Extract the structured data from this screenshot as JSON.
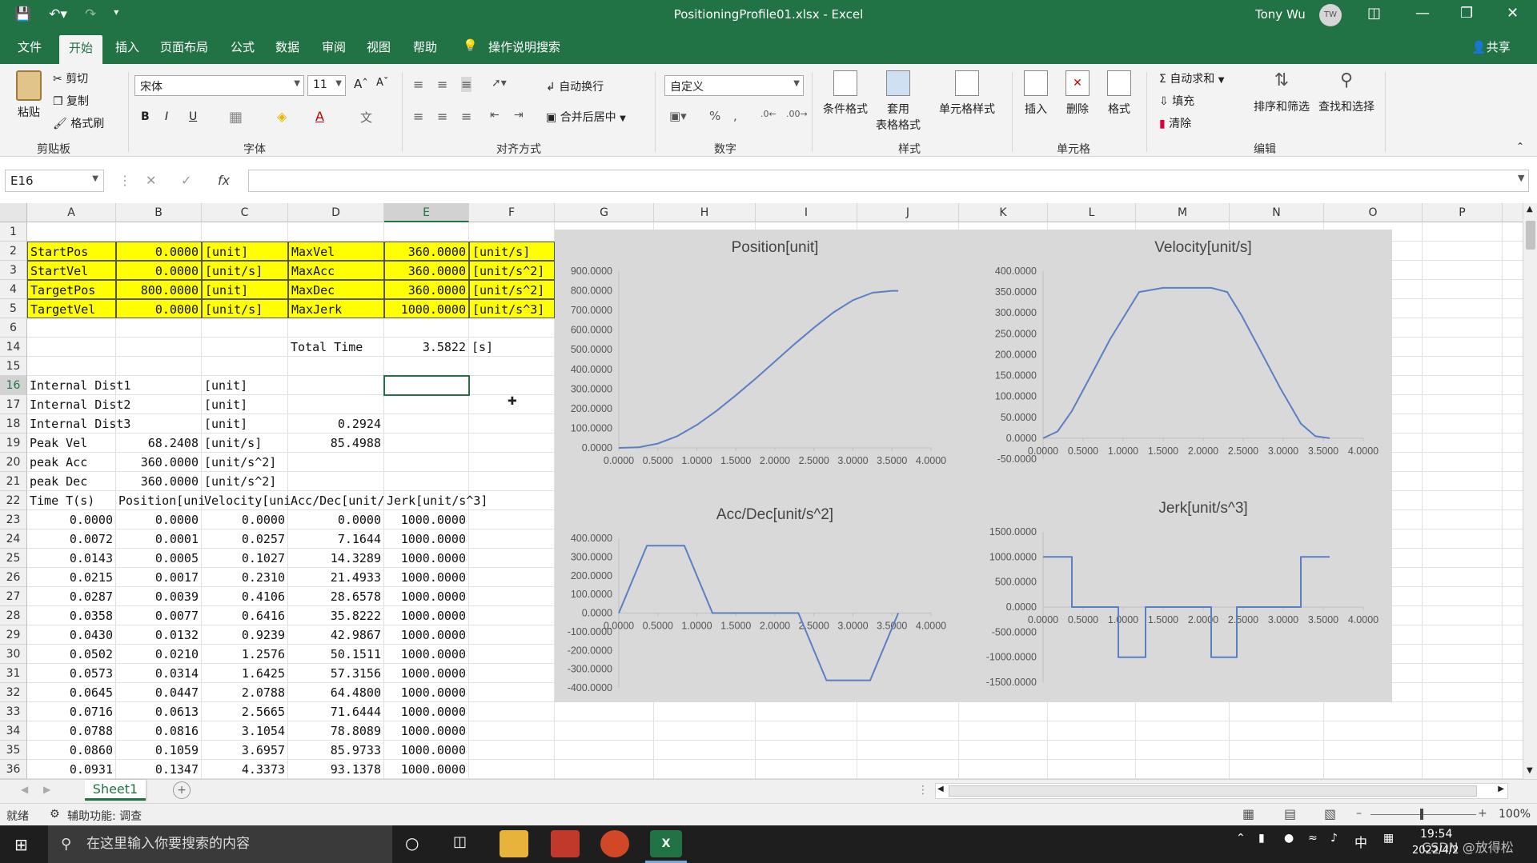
{
  "window": {
    "title": "PositioningProfile01.xlsx  -  Excel",
    "user": "Tony Wu",
    "avatar": "TW"
  },
  "menu_tabs": [
    "文件",
    "开始",
    "插入",
    "页面布局",
    "公式",
    "数据",
    "审阅",
    "视图",
    "帮助",
    "操作说明搜索"
  ],
  "share_label": "共享",
  "ribbon": {
    "clipboard": {
      "paste": "粘贴",
      "cut": "剪切",
      "copy": "复制",
      "format_painter": "格式刷",
      "label": "剪贴板"
    },
    "font": {
      "name": "宋体",
      "size": "11",
      "label": "字体"
    },
    "alignment": {
      "wrap": "自动换行",
      "merge": "合并后居中",
      "label": "对齐方式"
    },
    "number": {
      "format": "自定义",
      "label": "数字"
    },
    "styles": {
      "conditional": "条件格式",
      "table_line1": "套用",
      "table_line2": "表格格式",
      "cell_style": "单元格样式",
      "label": "样式"
    },
    "cells": {
      "insert": "插入",
      "delete": "删除",
      "format": "格式",
      "label": "单元格"
    },
    "editing": {
      "autosum": "自动求和",
      "fill": "填充",
      "clear": "清除",
      "sort": "排序和筛选",
      "find": "查找和选择",
      "label": "编辑"
    }
  },
  "formula_bar": {
    "name_box": "E16",
    "formula": ""
  },
  "columns": [
    "A",
    "B",
    "C",
    "D",
    "E",
    "F",
    "G",
    "H",
    "I",
    "J",
    "K",
    "L",
    "M",
    "N",
    "O",
    "P",
    "Q",
    "R",
    "S"
  ],
  "rows": [
    {
      "n": "1",
      "cells": [
        "",
        "",
        "",
        "",
        "",
        ""
      ]
    },
    {
      "n": "2",
      "cells": [
        "StartPos",
        "0.0000",
        "[unit]",
        "MaxVel",
        "360.0000",
        "[unit/s]"
      ]
    },
    {
      "n": "3",
      "cells": [
        "StartVel",
        "0.0000",
        "[unit/s]",
        "MaxAcc",
        "360.0000",
        "[unit/s^2]"
      ]
    },
    {
      "n": "4",
      "cells": [
        "TargetPos",
        "800.0000",
        "[unit]",
        "MaxDec",
        "360.0000",
        "[unit/s^2]"
      ]
    },
    {
      "n": "5",
      "cells": [
        "TargetVel",
        "0.0000",
        "[unit/s]",
        "MaxJerk",
        "1000.0000",
        "[unit/s^3]"
      ]
    },
    {
      "n": "6",
      "cells": [
        "",
        "",
        "",
        "",
        "",
        ""
      ]
    },
    {
      "n": "14",
      "cells": [
        "",
        "",
        "",
        "Total Time",
        "3.5822",
        "[s]"
      ]
    },
    {
      "n": "15",
      "cells": [
        "",
        "",
        "",
        "",
        "",
        ""
      ]
    },
    {
      "n": "16",
      "cells": [
        "Internal Dist1",
        "",
        "[unit]",
        "",
        "",
        ""
      ]
    },
    {
      "n": "17",
      "cells": [
        "Internal Dist2",
        "",
        "[unit]",
        "",
        "",
        ""
      ]
    },
    {
      "n": "18",
      "cells": [
        "Internal Dist3",
        "",
        "[unit]",
        "0.2924",
        "",
        ""
      ]
    },
    {
      "n": "19",
      "cells": [
        "Peak Vel",
        "68.2408",
        "[unit/s]",
        "85.4988",
        "",
        ""
      ]
    },
    {
      "n": "20",
      "cells": [
        "peak Acc",
        "360.0000",
        "[unit/s^2]",
        "",
        "",
        ""
      ]
    },
    {
      "n": "21",
      "cells": [
        "peak Dec",
        "360.0000",
        "[unit/s^2]",
        "",
        "",
        ""
      ]
    },
    {
      "n": "22",
      "cells": [
        "Time T(s)",
        "Position[uni",
        "Velocity[uni",
        "Acc/Dec[unit/",
        "Jerk[unit/s^3]",
        ""
      ]
    },
    {
      "n": "23",
      "cells": [
        "0.0000",
        "0.0000",
        "0.0000",
        "0.0000",
        "1000.0000",
        ""
      ]
    },
    {
      "n": "24",
      "cells": [
        "0.0072",
        "0.0001",
        "0.0257",
        "7.1644",
        "1000.0000",
        ""
      ]
    },
    {
      "n": "25",
      "cells": [
        "0.0143",
        "0.0005",
        "0.1027",
        "14.3289",
        "1000.0000",
        ""
      ]
    },
    {
      "n": "26",
      "cells": [
        "0.0215",
        "0.0017",
        "0.2310",
        "21.4933",
        "1000.0000",
        ""
      ]
    },
    {
      "n": "27",
      "cells": [
        "0.0287",
        "0.0039",
        "0.4106",
        "28.6578",
        "1000.0000",
        ""
      ]
    },
    {
      "n": "28",
      "cells": [
        "0.0358",
        "0.0077",
        "0.6416",
        "35.8222",
        "1000.0000",
        ""
      ]
    },
    {
      "n": "29",
      "cells": [
        "0.0430",
        "0.0132",
        "0.9239",
        "42.9867",
        "1000.0000",
        ""
      ]
    },
    {
      "n": "30",
      "cells": [
        "0.0502",
        "0.0210",
        "1.2576",
        "50.1511",
        "1000.0000",
        ""
      ]
    },
    {
      "n": "31",
      "cells": [
        "0.0573",
        "0.0314",
        "1.6425",
        "57.3156",
        "1000.0000",
        ""
      ]
    },
    {
      "n": "32",
      "cells": [
        "0.0645",
        "0.0447",
        "2.0788",
        "64.4800",
        "1000.0000",
        ""
      ]
    },
    {
      "n": "33",
      "cells": [
        "0.0716",
        "0.0613",
        "2.5665",
        "71.6444",
        "1000.0000",
        ""
      ]
    },
    {
      "n": "34",
      "cells": [
        "0.0788",
        "0.0816",
        "3.1054",
        "78.8089",
        "1000.0000",
        ""
      ]
    },
    {
      "n": "35",
      "cells": [
        "0.0860",
        "0.1059",
        "3.6957",
        "85.9733",
        "1000.0000",
        ""
      ]
    },
    {
      "n": "36",
      "cells": [
        "0.0931",
        "0.1347",
        "4.3373",
        "93.1378",
        "1000.0000",
        ""
      ]
    }
  ],
  "chart_data": [
    {
      "type": "line",
      "title": "Position[unit]",
      "xlim": [
        0,
        4
      ],
      "ylim": [
        0,
        900
      ],
      "x_ticks": [
        "0.0000",
        "0.5000",
        "1.0000",
        "1.5000",
        "2.0000",
        "2.5000",
        "3.0000",
        "3.5000",
        "4.0000"
      ],
      "y_ticks": [
        "0.0000",
        "100.0000",
        "200.0000",
        "300.0000",
        "400.0000",
        "500.0000",
        "600.0000",
        "700.0000",
        "800.0000",
        "900.0000"
      ],
      "x": [
        0,
        0.25,
        0.5,
        0.75,
        1.0,
        1.25,
        1.5,
        1.75,
        2.0,
        2.25,
        2.5,
        2.75,
        3.0,
        3.25,
        3.5,
        3.58
      ],
      "y": [
        0,
        3,
        22,
        60,
        117,
        188,
        268,
        352,
        440,
        528,
        612,
        690,
        752,
        790,
        800,
        800
      ]
    },
    {
      "type": "line",
      "title": "Velocity[unit/s]",
      "xlim": [
        0,
        4
      ],
      "ylim": [
        -50,
        400
      ],
      "x_ticks": [
        "0.0000",
        "0.5000",
        "1.0000",
        "1.5000",
        "2.0000",
        "2.5000",
        "3.0000",
        "3.5000",
        "4.0000"
      ],
      "y_ticks": [
        "-50.0000",
        "0.0000",
        "50.0000",
        "100.0000",
        "150.0000",
        "200.0000",
        "250.0000",
        "300.0000",
        "350.0000",
        "400.0000"
      ],
      "x": [
        0,
        0.18,
        0.36,
        0.6,
        0.84,
        1.02,
        1.2,
        1.5,
        1.8,
        2.1,
        2.3,
        2.48,
        2.72,
        2.96,
        3.22,
        3.4,
        3.58
      ],
      "y": [
        0,
        16,
        65,
        151,
        238,
        294,
        350,
        360,
        360,
        360,
        350,
        294,
        208,
        121,
        35,
        5,
        0
      ]
    },
    {
      "type": "line",
      "title": "Acc/Dec[unit/s^2]",
      "xlim": [
        0,
        4
      ],
      "ylim": [
        -400,
        400
      ],
      "x_ticks": [
        "0.0000",
        "0.5000",
        "1.0000",
        "1.5000",
        "2.0000",
        "2.5000",
        "3.0000",
        "3.5000",
        "4.0000"
      ],
      "y_ticks": [
        "-400.0000",
        "-300.0000",
        "-200.0000",
        "-100.0000",
        "0.0000",
        "100.0000",
        "200.0000",
        "300.0000",
        "400.0000"
      ],
      "x": [
        0,
        0.36,
        0.84,
        1.2,
        2.3,
        2.66,
        3.22,
        3.58
      ],
      "y": [
        0,
        360,
        360,
        0,
        0,
        -360,
        -360,
        0
      ]
    },
    {
      "type": "line",
      "title": "Jerk[unit/s^3]",
      "xlim": [
        0,
        4
      ],
      "ylim": [
        -1500,
        1500
      ],
      "x_ticks": [
        "0.0000",
        "0.5000",
        "1.0000",
        "1.5000",
        "2.0000",
        "2.5000",
        "3.0000",
        "3.5000",
        "4.0000"
      ],
      "y_ticks": [
        "-1500.0000",
        "-1000.0000",
        "-500.0000",
        "0.0000",
        "500.0000",
        "1000.0000",
        "1500.0000"
      ],
      "x": [
        0,
        0.36,
        0.36,
        0.94,
        0.94,
        1.28,
        1.28,
        2.1,
        2.1,
        2.42,
        2.42,
        3.22,
        3.22,
        3.58
      ],
      "y": [
        1000,
        1000,
        0,
        0,
        -1000,
        -1000,
        0,
        0,
        -1000,
        -1000,
        0,
        0,
        1000,
        1000
      ]
    }
  ],
  "sheet_tabs": [
    "Sheet1"
  ],
  "status": {
    "ready": "就绪",
    "accessibility": "辅助功能: 调查",
    "zoom": "100%"
  },
  "taskbar": {
    "search_placeholder": "在这里输入你要搜索的内容",
    "time": "19:54",
    "date": "2022/4/2",
    "lang": "中",
    "watermark": "CSDN @放得松"
  },
  "colors": {
    "excel_green": "#217346",
    "highlight_yellow": "#ffff00",
    "series_blue": "#5b7fc0"
  }
}
